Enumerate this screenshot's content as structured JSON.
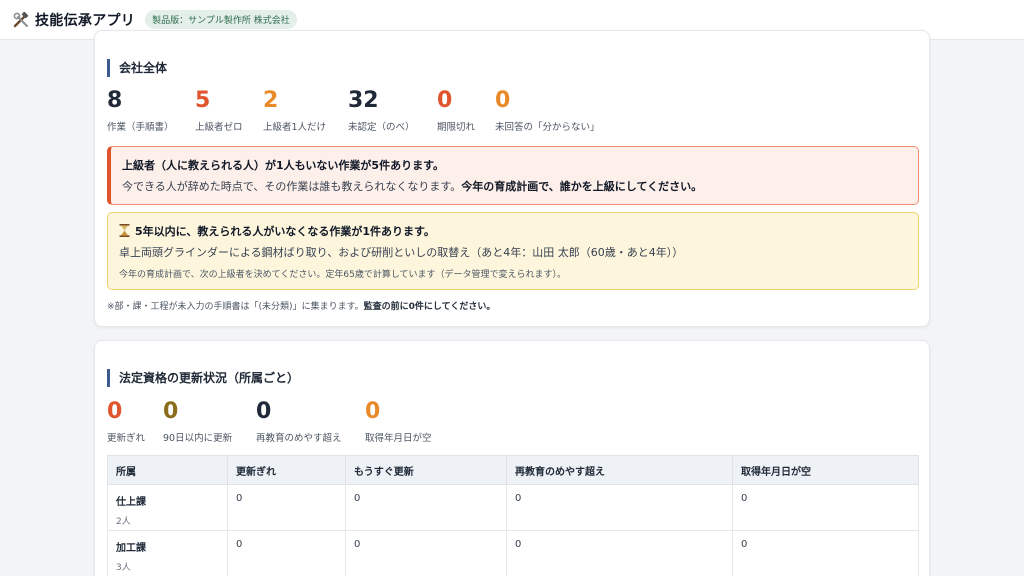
{
  "header": {
    "app_title": "技能伝承アプリ",
    "edition_badge": "製品版：サンプル製作所 株式会社",
    "logo_icon": "tools-icon"
  },
  "company_overview": {
    "title": "会社全体",
    "stats": [
      {
        "value": "8",
        "label": "作業（手順書）",
        "color": "#1f2937"
      },
      {
        "value": "5",
        "label": "上級者ゼロ",
        "color": "#e0552d"
      },
      {
        "value": "2",
        "label": "上級者1人だけ",
        "color": "#e88a2a"
      },
      {
        "value": "32",
        "label": "未認定（のべ）",
        "color": "#1f2937"
      },
      {
        "value": "0",
        "label": "期限切れ",
        "color": "#e0552d"
      },
      {
        "value": "0",
        "label": "未回答の「分からない」",
        "color": "#e88a2a"
      }
    ],
    "alert_red": {
      "title": "上級者（人に教えられる人）が1人もいない作業が5件あります。",
      "text": "今できる人が辞めた時点で、その作業は誰も教えられなくなります。",
      "text_bold": "今年の育成計画で、誰かを上級にしてください。"
    },
    "alert_yellow": {
      "icon": "hourglass-icon",
      "title": "5年以内に、教えられる人がいなくなる作業が1件あります。",
      "text": "卓上両頭グラインダーによる鋼材ばり取り、および研削といしの取替え（あと4年：山田 太郎（60歳・あと4年））",
      "sub": "今年の育成計画で、次の上級者を決めてください。定年65歳で計算しています（データ管理で変えられます）。"
    },
    "note": "※部・課・工程が未入力の手順書は「(未分類)」に集まります。",
    "note_bold": "監査の前に0件にしてください。"
  },
  "certifications": {
    "title": "法定資格の更新状況（所属ごと）",
    "stats": [
      {
        "value": "0",
        "label": "更新ぎれ",
        "color": "#e0552d"
      },
      {
        "value": "0",
        "label": "90日以内に更新",
        "color": "#8a6d1a"
      },
      {
        "value": "0",
        "label": "再教育のめやす超え",
        "color": "#1f2937"
      },
      {
        "value": "0",
        "label": "取得年月日が空",
        "color": "#e88a2a"
      }
    ],
    "table": {
      "headers": [
        "所属",
        "更新ぎれ",
        "もうすぐ更新",
        "再教育のめやす超え",
        "取得年月日が空"
      ],
      "rows": [
        {
          "dept": "仕上課",
          "count": "2人",
          "cells": [
            "0",
            "0",
            "0",
            "0"
          ]
        },
        {
          "dept": "加工課",
          "count": "3人",
          "cells": [
            "0",
            "0",
            "0",
            "0"
          ]
        }
      ]
    }
  }
}
